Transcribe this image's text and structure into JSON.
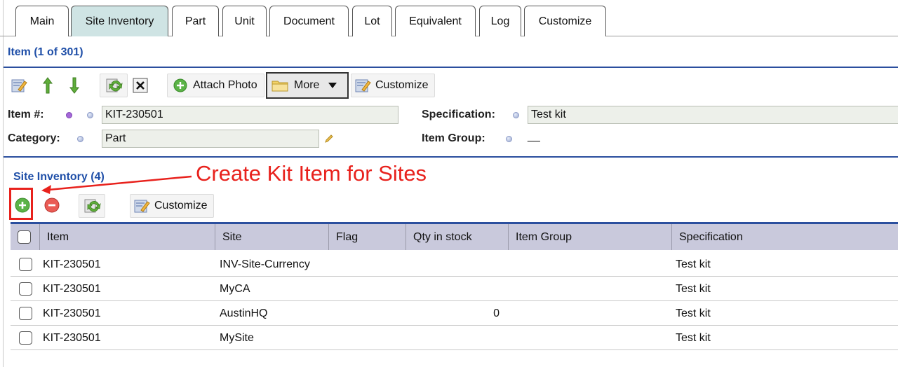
{
  "tabs": [
    {
      "label": "Main",
      "active": false
    },
    {
      "label": "Site Inventory",
      "active": true
    },
    {
      "label": "Part",
      "active": false
    },
    {
      "label": "Unit",
      "active": false
    },
    {
      "label": "Document",
      "active": false
    },
    {
      "label": "Lot",
      "active": false
    },
    {
      "label": "Equivalent",
      "active": false
    },
    {
      "label": "Log",
      "active": false
    },
    {
      "label": "Customize",
      "active": false
    }
  ],
  "item_section": {
    "title": "Item (1 of 301)",
    "toolbar": {
      "attach_photo_label": "Attach Photo",
      "more_label": "More",
      "customize_label": "Customize"
    },
    "fields": {
      "item_no_label": "Item #:",
      "item_no_value": "KIT-230501",
      "category_label": "Category:",
      "category_value": "Part",
      "specification_label": "Specification:",
      "specification_value": "Test kit",
      "item_group_label": "Item Group:",
      "item_group_value": "__"
    }
  },
  "site_inventory": {
    "title": "Site Inventory (4)",
    "annotation": "Create Kit Item for Sites",
    "toolbar": {
      "customize_label": "Customize"
    },
    "columns": [
      "Item",
      "Site",
      "Flag",
      "Qty in stock",
      "Item Group",
      "Specification"
    ],
    "rows": [
      {
        "item": "KIT-230501",
        "site": "INV-Site-Currency",
        "flag": "",
        "qty": "",
        "item_group": "",
        "specification": "Test kit"
      },
      {
        "item": "KIT-230501",
        "site": "MyCA",
        "flag": "",
        "qty": "",
        "item_group": "",
        "specification": "Test kit"
      },
      {
        "item": "KIT-230501",
        "site": "AustinHQ",
        "flag": "",
        "qty": "0",
        "item_group": "",
        "specification": "Test kit"
      },
      {
        "item": "KIT-230501",
        "site": "MySite",
        "flag": "",
        "qty": "",
        "item_group": "",
        "specification": "Test kit"
      }
    ]
  },
  "colors": {
    "accent_blue": "#2b4f9e",
    "title_blue": "#1f4fa8",
    "active_tab": "#cfe4e4",
    "annotation_red": "#e8211c",
    "table_header": "#c9c9dc",
    "field_bg": "#edf0ea"
  },
  "icons": [
    "edit-icon",
    "arrow-up-icon",
    "arrow-down-icon",
    "refresh-icon",
    "close-icon",
    "add-icon",
    "folder-icon",
    "dropdown-arrow-icon",
    "customize-icon",
    "remove-icon",
    "pencil-icon"
  ]
}
